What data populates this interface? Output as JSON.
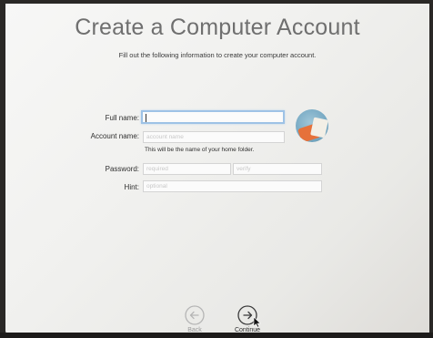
{
  "page": {
    "title": "Create a Computer Account",
    "subtitle": "Fill out the following information to create your computer account."
  },
  "form": {
    "full_name": {
      "label": "Full name:",
      "value": ""
    },
    "account_name": {
      "label": "Account name:",
      "placeholder": "account name",
      "hint": "This will be the name of your home folder."
    },
    "password": {
      "label": "Password:",
      "placeholder": "required",
      "verify_placeholder": "verify"
    },
    "hint": {
      "label": "Hint:",
      "placeholder": "optional"
    }
  },
  "nav": {
    "back_label": "Back",
    "continue_label": "Continue"
  },
  "colors": {
    "focus_ring": "#9ec2e6",
    "title_text": "#6f6f6f"
  }
}
